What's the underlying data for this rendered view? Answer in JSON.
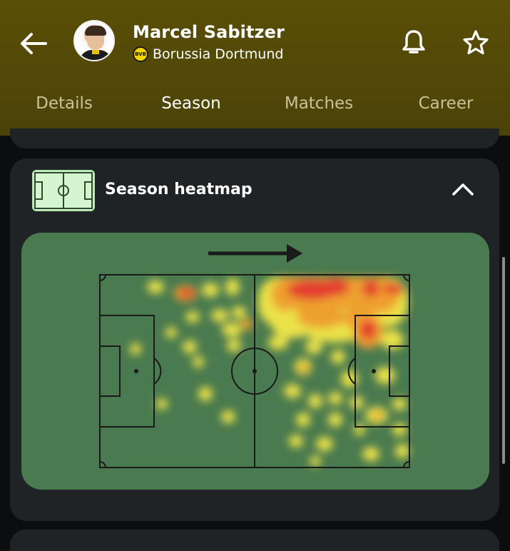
{
  "header": {
    "player_name": "Marcel Sabitzer",
    "club_name": "Borussia Dortmund",
    "club_logo_text": "BVB",
    "background_color": "#524808",
    "icons": {
      "back": "arrow-left-icon",
      "notifications": "bell-icon",
      "favorite": "star-icon"
    }
  },
  "tabs": [
    {
      "label": "Details",
      "active": false
    },
    {
      "label": "Season",
      "active": true
    },
    {
      "label": "Matches",
      "active": false
    },
    {
      "label": "Career",
      "active": false
    }
  ],
  "heatmap_card": {
    "title": "Season heatmap",
    "expanded": true,
    "attack_direction": "right",
    "pitch_color": "#4a7a4f",
    "heat_colors": [
      "#f4e84a",
      "#f7a32f",
      "#ee3b2e"
    ]
  }
}
